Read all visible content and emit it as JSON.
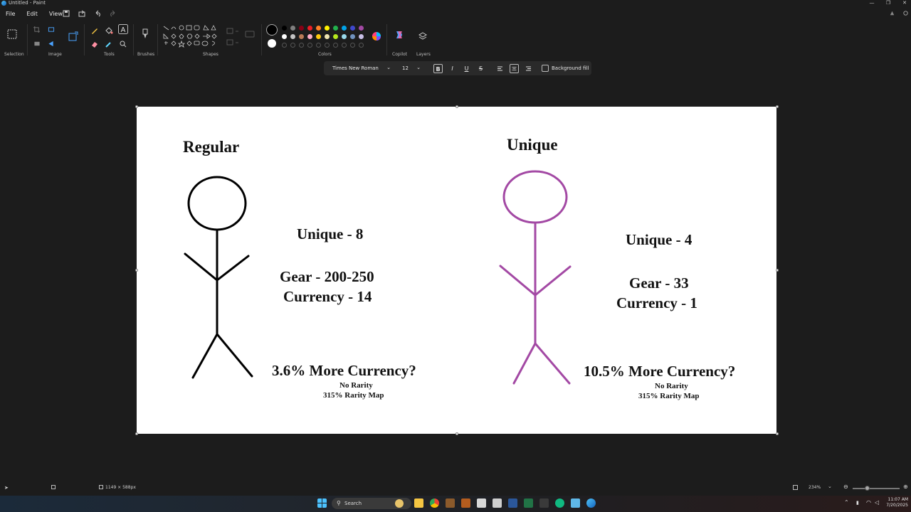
{
  "window": {
    "title": "Untitled - Paint",
    "minimize": "—",
    "maximize": "❐",
    "close": "✕"
  },
  "menu": {
    "file": "File",
    "edit": "Edit",
    "view": "View"
  },
  "ribbon": {
    "groups": {
      "selection": "Selection",
      "image": "Image",
      "tools": "Tools",
      "brushes": "Brushes",
      "shapes": "Shapes",
      "colors": "Colors",
      "copilot": "Copilot",
      "layers": "Layers"
    },
    "colors": {
      "primary": "#000000",
      "secondary": "#ffffff",
      "row1": [
        "#000000",
        "#7f7f7f",
        "#880015",
        "#ed1c24",
        "#ff7f27",
        "#fff200",
        "#22b14c",
        "#00a2e8",
        "#3f48cc",
        "#a349a4"
      ],
      "row2": [
        "#ffffff",
        "#c3c3c3",
        "#b97a57",
        "#ffaec9",
        "#ffc90e",
        "#efe4b0",
        "#b5e61d",
        "#99d9ea",
        "#7092be",
        "#c8bfe7"
      ]
    }
  },
  "text_toolbar": {
    "font": "Times New Roman",
    "size": "12",
    "bold": "B",
    "italic": "I",
    "underline": "U",
    "strike": "S",
    "background_fill": "Background fill"
  },
  "canvas": {
    "left_title": "Regular",
    "left_unique": "Unique - 8",
    "left_gear": "Gear - 200-250",
    "left_currency": "Currency - 14",
    "left_more": "3.6% More Currency?",
    "left_note1": "No Rarity",
    "left_note2": "315% Rarity Map",
    "right_title": "Unique",
    "right_unique": "Unique - 4",
    "right_gear": "Gear - 33",
    "right_currency": "Currency - 1",
    "right_more": "10.5% More Currency?",
    "right_note1": "No Rarity",
    "right_note2": "315% Rarity Map",
    "left_figure_color": "#000000",
    "right_figure_color": "#a349a4"
  },
  "status": {
    "dimensions": "1149 × 588px",
    "zoom": "234%"
  },
  "taskbar": {
    "search": "Search",
    "time": "11:07 AM",
    "date": "7/20/2025"
  }
}
